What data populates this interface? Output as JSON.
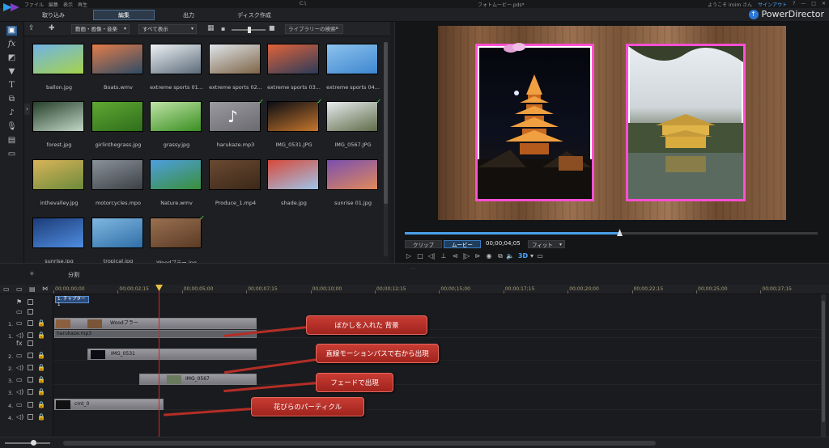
{
  "titlebar": {
    "menus": [
      "ファイル",
      "編集",
      "表示",
      "再生"
    ],
    "filename": "C:\\",
    "project": "フォトムービー.pds*",
    "welcome": "ようこそ iroim さん",
    "signout": "サインアウト",
    "help": "?"
  },
  "modes": {
    "tabs": [
      "取り込み",
      "編集",
      "出力",
      "ディスク作成"
    ],
    "active": "編集",
    "brand": "PowerDirector"
  },
  "library_toolbar": {
    "filter": "動画・画像・音楽",
    "view": "すべて表示",
    "search_placeholder": "ライブラリーの検索"
  },
  "media": [
    {
      "name": "ballon.jpg",
      "checked": false,
      "colors": [
        "#6fb4e6",
        "#a7d24b"
      ]
    },
    {
      "name": "Boats.wmv",
      "checked": false,
      "colors": [
        "#e37d4a",
        "#2f4b66"
      ]
    },
    {
      "name": "extreme sports 01...",
      "checked": false,
      "colors": [
        "#eef2f5",
        "#5c6b7a"
      ]
    },
    {
      "name": "extreme sports 02...",
      "checked": false,
      "colors": [
        "#dfe5ea",
        "#7e6446"
      ]
    },
    {
      "name": "extreme sports 03...",
      "checked": false,
      "colors": [
        "#e0633a",
        "#2b3b5a"
      ]
    },
    {
      "name": "extreme sports 04...",
      "checked": false,
      "colors": [
        "#8dc3ee",
        "#3e86cf"
      ]
    },
    {
      "name": "forest.jpg",
      "checked": false,
      "colors": [
        "#25402a",
        "#c2d7c7"
      ]
    },
    {
      "name": "girlinthegrass.jpg",
      "checked": false,
      "colors": [
        "#5fa832",
        "#2f6e1c"
      ]
    },
    {
      "name": "grassy.jpg",
      "checked": false,
      "colors": [
        "#bfe3a5",
        "#3a8f22"
      ]
    },
    {
      "name": "harukaze.mp3",
      "checked": true,
      "colors": [
        "#9a9aa0",
        "#6a6a70"
      ]
    },
    {
      "name": "IMG_0531.JPG",
      "checked": true,
      "colors": [
        "#0c0d14",
        "#c5762c"
      ]
    },
    {
      "name": "IMG_0567.JPG",
      "checked": true,
      "colors": [
        "#e7ebee",
        "#5f6c48"
      ]
    },
    {
      "name": "inthevalley.jpg",
      "checked": false,
      "colors": [
        "#d9b45a",
        "#6c8a3a"
      ]
    },
    {
      "name": "motorcycles.mpo",
      "checked": false,
      "colors": [
        "#8a929a",
        "#3c4046"
      ]
    },
    {
      "name": "Nature.wmv",
      "checked": false,
      "colors": [
        "#4e9fe0",
        "#3a8f3a"
      ]
    },
    {
      "name": "Produce_1.mp4",
      "checked": false,
      "colors": [
        "#6a4a32",
        "#3b2818"
      ]
    },
    {
      "name": "shade.jpg",
      "checked": false,
      "colors": [
        "#d74a3a",
        "#9fc5ea"
      ]
    },
    {
      "name": "sunrise 01.jpg",
      "checked": false,
      "colors": [
        "#7a4fb0",
        "#e08a5a"
      ]
    },
    {
      "name": "sunrise.jpg",
      "checked": false,
      "colors": [
        "#1c3c78",
        "#4f8de0"
      ]
    },
    {
      "name": "tropical.jpg",
      "checked": false,
      "colors": [
        "#7fb7e0",
        "#2f6fa8"
      ]
    },
    {
      "name": "Woodブラー.jpg",
      "checked": true,
      "colors": [
        "#9a7050",
        "#5a3b26"
      ]
    }
  ],
  "preview": {
    "tab_clip": "クリップ",
    "tab_movie": "ムービー",
    "timecode": "00;00;04;05",
    "fit": "フィット",
    "threed": "3D"
  },
  "midbar": {
    "split": "分割"
  },
  "timeline": {
    "ruler": [
      "00;00;00;00",
      "00;00;02;15",
      "00;00;05;00",
      "00;00;07;15",
      "00;00;10;00",
      "00;00;12;15",
      "00;00;15;00",
      "00;00;17;15",
      "00;00;20;00",
      "00;00;22;15",
      "00;00;25;00",
      "00;00;27;15"
    ],
    "chapter": "1. チャプター 1",
    "tracks": [
      {
        "num": "1.",
        "video_clip": "Woodブラー",
        "audio_clip": "harukaze.mp3"
      },
      {
        "num": "2.",
        "video_clip": "IMG_0531"
      },
      {
        "num": "3.",
        "video_clip": "IMG_0567"
      },
      {
        "num": "4.",
        "video_clip": "cmt_0"
      }
    ]
  },
  "callouts": [
    "ぼかしを入れた 背景",
    "直線モーションパスで右から出現",
    "フェードで出現",
    "花びらのパーティクル"
  ]
}
